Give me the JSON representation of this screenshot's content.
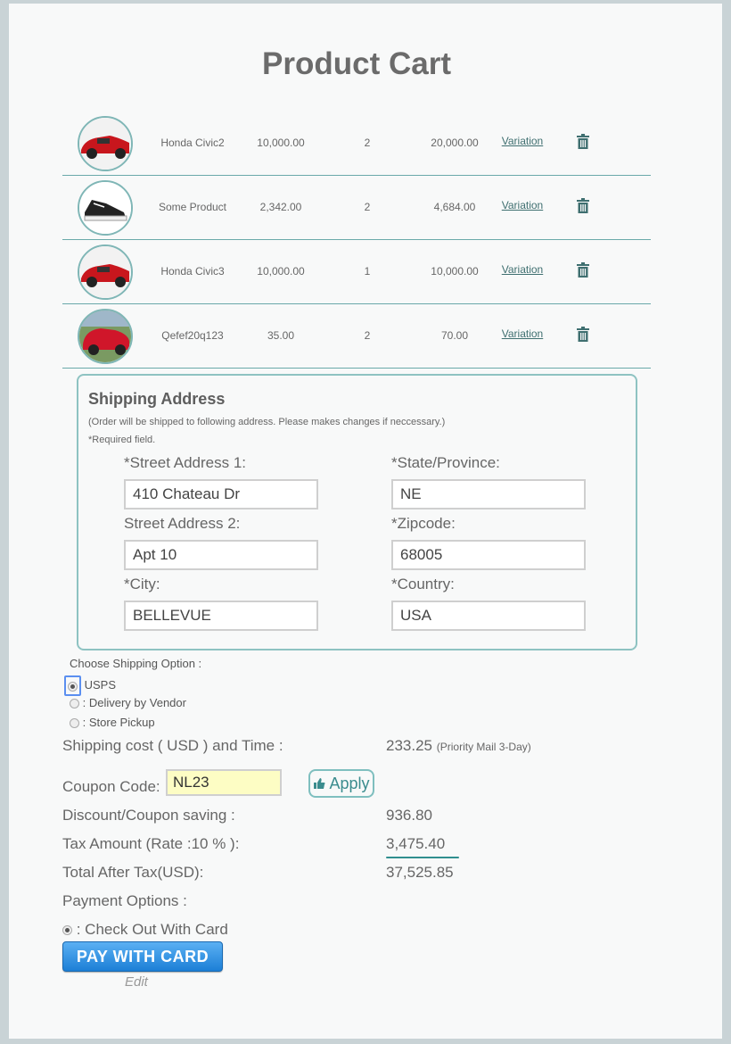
{
  "page": {
    "title": "Product Cart"
  },
  "cart": {
    "items": [
      {
        "name": "Honda Civic2",
        "price": "10,000.00",
        "qty": "2",
        "total": "20,000.00",
        "variation": "Variation",
        "image": "red-car"
      },
      {
        "name": "Some Product",
        "price": "2,342.00",
        "qty": "2",
        "total": "4,684.00",
        "variation": "Variation",
        "image": "sneaker"
      },
      {
        "name": "Honda Civic3",
        "price": "10,000.00",
        "qty": "1",
        "total": "10,000.00",
        "variation": "Variation",
        "image": "red-car"
      },
      {
        "name": "Qefef20q123",
        "price": "35.00",
        "qty": "2",
        "total": "70.00",
        "variation": "Variation",
        "image": "red-car-outdoor"
      }
    ]
  },
  "shipping": {
    "title": "Shipping Address",
    "note": "(Order will be shipped to following address. Please makes changes if neccessary.)",
    "required_note": "*Required field.",
    "street1_label": "*Street Address 1:",
    "street1_value": "410 Chateau Dr",
    "street2_label": "Street Address 2:",
    "street2_value": "Apt 10",
    "city_label": "*City:",
    "city_value": "BELLEVUE",
    "state_label": "*State/Province:",
    "state_value": "NE",
    "zip_label": "*Zipcode:",
    "zip_value": "68005",
    "country_label": "*Country:",
    "country_value": "USA"
  },
  "shipping_options": {
    "title": "Choose Shipping Option :",
    "options": [
      "USPS",
      ": Delivery by Vendor",
      ": Store Pickup"
    ],
    "selected": "USPS"
  },
  "summary": {
    "shipping_cost_label": "Shipping cost ( USD ) and Time :",
    "shipping_cost_value": "233.25",
    "shipping_time": "(Priority Mail 3-Day)",
    "coupon_label": "Coupon Code:",
    "coupon_value": "NL23",
    "apply_label": "Apply",
    "discount_label": "Discount/Coupon saving :",
    "discount_value": "936.80",
    "tax_label": "Tax Amount (Rate :10 % ):",
    "tax_value": "3,475.40",
    "total_label": "Total After Tax(USD):",
    "total_value": "37,525.85"
  },
  "payment": {
    "title": "Payment Options :",
    "option_label": ": Check Out With Card",
    "pay_button": "PAY WITH CARD",
    "edit_label": "Edit"
  },
  "colors": {
    "accent": "#6aa9aa",
    "pay_button": "#2a8fe0",
    "coupon_bg": "#fdfdc4"
  }
}
